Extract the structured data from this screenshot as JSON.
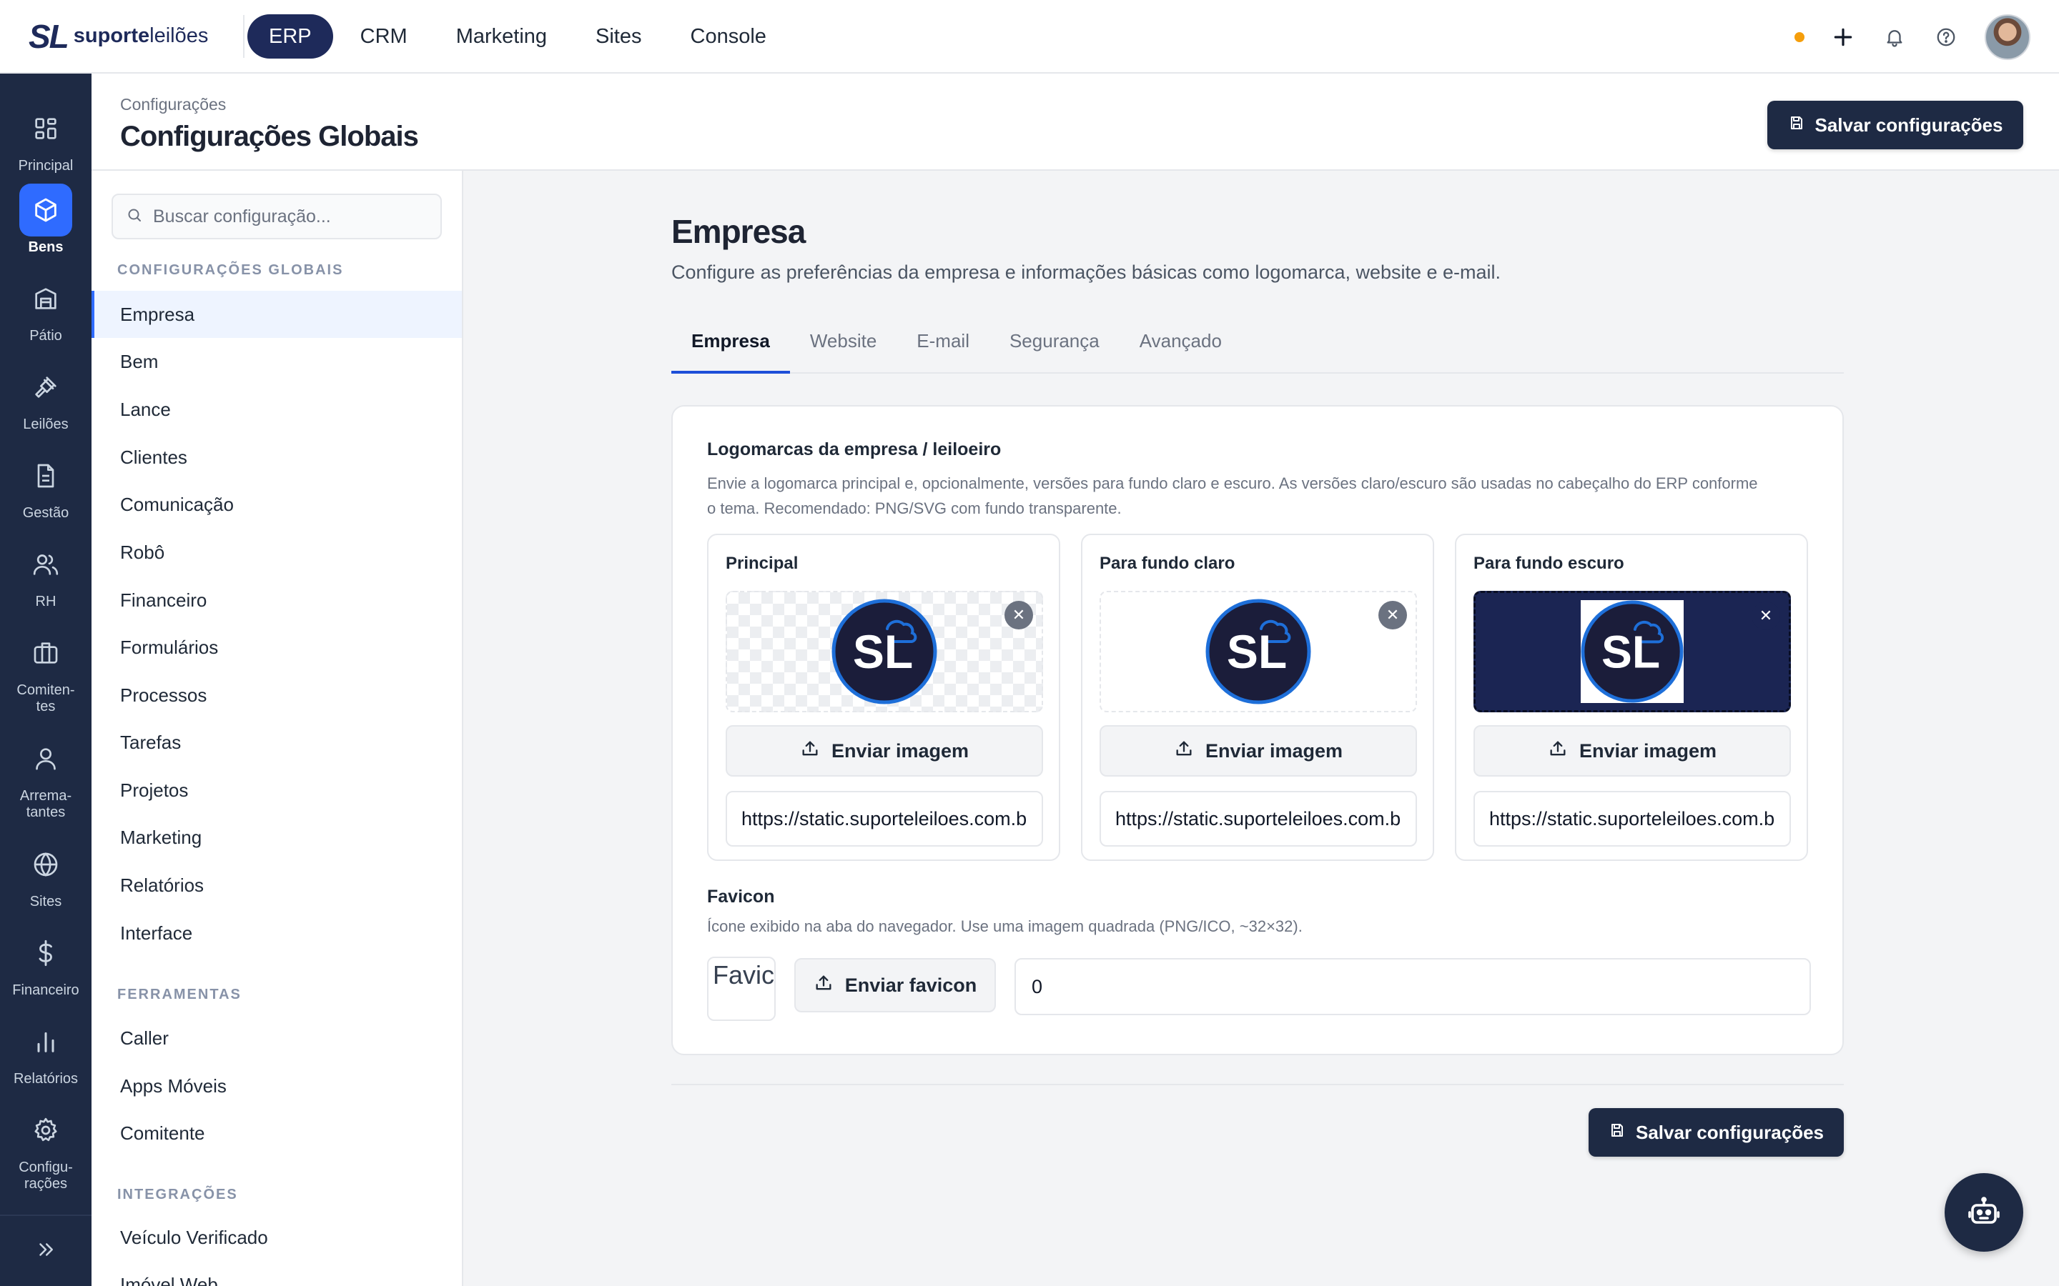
{
  "brand": {
    "mark": "SL",
    "name_bold": "suporte",
    "name_light": "leilões"
  },
  "topnav": [
    {
      "label": "ERP",
      "active": true
    },
    {
      "label": "CRM"
    },
    {
      "label": "Marketing"
    },
    {
      "label": "Sites"
    },
    {
      "label": "Console"
    }
  ],
  "rail": [
    {
      "label": "Principal",
      "icon": "grid-icon"
    },
    {
      "label": "Bens",
      "icon": "box-icon",
      "active": true
    },
    {
      "label": "Pátio",
      "icon": "warehouse-icon"
    },
    {
      "label": "Leilões",
      "icon": "gavel-icon"
    },
    {
      "label": "Gestão",
      "icon": "document-icon"
    },
    {
      "label": "RH",
      "icon": "users-icon"
    },
    {
      "label": "Comiten-\ntes",
      "icon": "briefcase-icon"
    },
    {
      "label": "Arrema-\ntantes",
      "icon": "user-icon"
    },
    {
      "label": "Sites",
      "icon": "globe-icon"
    },
    {
      "label": "Financeiro",
      "icon": "dollar-icon"
    },
    {
      "label": "Relatórios",
      "icon": "bar-chart-icon"
    },
    {
      "label": "Configu-\nrações",
      "icon": "gear-icon"
    }
  ],
  "header": {
    "breadcrumb": "Configurações",
    "title": "Configurações Globais",
    "save_label": "Salvar configurações"
  },
  "settings_nav": {
    "search_placeholder": "Buscar configuração...",
    "sections": [
      {
        "title": "CONFIGURAÇÕES GLOBAIS",
        "items": [
          "Empresa",
          "Bem",
          "Lance",
          "Clientes",
          "Comunicação",
          "Robô",
          "Financeiro",
          "Formulários",
          "Processos",
          "Tarefas",
          "Projetos",
          "Marketing",
          "Relatórios",
          "Interface"
        ]
      },
      {
        "title": "FERRAMENTAS",
        "items": [
          "Caller",
          "Apps Móveis",
          "Comitente"
        ]
      },
      {
        "title": "INTEGRAÇÕES",
        "items": [
          "Veículo Verificado",
          "Imóvel Web"
        ]
      }
    ],
    "active": "Empresa"
  },
  "section": {
    "title": "Empresa",
    "description": "Configure as preferências da empresa e informações básicas como logomarca, website e e-mail."
  },
  "tabs": [
    {
      "label": "Empresa",
      "active": true
    },
    {
      "label": "Website"
    },
    {
      "label": "E-mail"
    },
    {
      "label": "Segurança"
    },
    {
      "label": "Avançado"
    }
  ],
  "logos": {
    "title": "Logomarcas da empresa / leiloeiro",
    "description": "Envie a logomarca principal e, opcionalmente, versões para fundo claro e escuro. As versões claro/escuro são usadas no cabeçalho do ERP conforme o tema. Recomendado: PNG/SVG com fundo transparente.",
    "upload_label": "Enviar imagem",
    "logo_text": "SL",
    "boxes": [
      {
        "title": "Principal",
        "url": "https://static.suporteleiloes.com.br/",
        "background": "checker"
      },
      {
        "title": "Para fundo claro",
        "url": "https://static.suporteleiloes.com.br/",
        "background": "light"
      },
      {
        "title": "Para fundo escuro",
        "url": "https://static.suporteleiloes.com.br/",
        "background": "dark"
      }
    ]
  },
  "favicon": {
    "title": "Favicon",
    "description": "Ícone exibido na aba do navegador. Use uma imagem quadrada (PNG/ICO, ~32×32).",
    "preview_alt": "Favicon",
    "upload_label": "Enviar favicon",
    "value": "0"
  },
  "colors": {
    "navy": "#1e2a44",
    "accent": "#2f6bff",
    "status_dot": "#f59e0b",
    "logo_dark_bg": "#1b2553"
  }
}
